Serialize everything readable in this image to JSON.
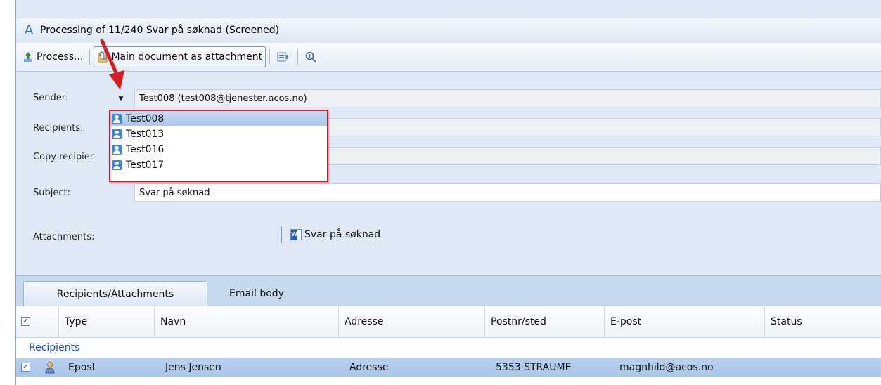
{
  "window": {
    "title": "Processing of 11/240 Svar på søknad (Screened)",
    "app_icon_letter": "A"
  },
  "toolbar": {
    "process_label": "Process...",
    "main_doc_label": "Main document as attachment"
  },
  "form": {
    "sender_label": "Sender:",
    "sender_value": "Test008 (test008@tjenester.acos.no)",
    "recipients_label": "Recipients:",
    "copy_label": "Copy recipier",
    "subject_label": "Subject:",
    "subject_value": "Svar på søknad",
    "attachments_label": "Attachments:",
    "attachment_name": "Svar på søknad"
  },
  "dropdown": {
    "items": [
      "Test008",
      "Test013",
      "Test016",
      "Test017"
    ],
    "selected_index": 0
  },
  "tabs": [
    {
      "label": "Recipients/Attachments",
      "active": true
    },
    {
      "label": "Email body",
      "active": false
    }
  ],
  "grid": {
    "columns": [
      "Type",
      "Navn",
      "Adresse",
      "Postnr/sted",
      "E-post",
      "Status"
    ],
    "group_label": "Recipients",
    "rows": [
      {
        "checked": true,
        "type": "Epost",
        "navn": "Jens Jensen",
        "adresse": "Adresse",
        "postnr": "5353 STRAUME",
        "epost": "magnhild@acos.no",
        "status": ""
      }
    ]
  },
  "colors": {
    "highlight_border": "#c81b24",
    "selection": "#a9c5ea",
    "link_blue": "#1d4fa4"
  }
}
